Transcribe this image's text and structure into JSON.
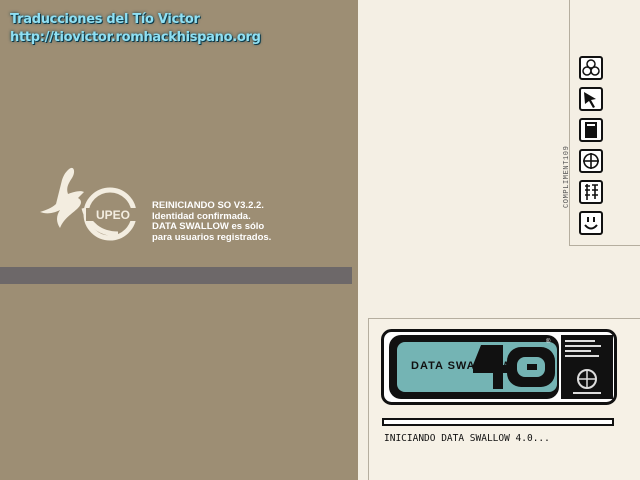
{
  "watermark": {
    "line1": "Traducciones del Tío Victor",
    "line2": "http://tiovictor.romhackhispano.org"
  },
  "logo": {
    "text": "UPEO"
  },
  "boot": {
    "line1": "REINICIANDO SO V3.2.2.",
    "line2": "Identidad confirmada.",
    "line3": "DATA SWALLOW es sólo",
    "line4": "para usuarios registrados."
  },
  "sidebar": {
    "label": "COMPLIMENT109",
    "icons": [
      "network-icon",
      "cursor-icon",
      "document-icon",
      "target-icon",
      "kanji-icon",
      "smiley-icon"
    ]
  },
  "data_swallow": {
    "logo_small": "DATA SWALLOW",
    "version_mark": "4.0",
    "progress_percent": 0,
    "status": "INICIANDO DATA SWALLOW 4.0..."
  },
  "colors": {
    "left_panel": "#9d8e74",
    "right_panel": "#f4efe4",
    "divider": "#6d6869",
    "logo_teal": "#74b4b4",
    "watermark": "#8fe0f4"
  }
}
